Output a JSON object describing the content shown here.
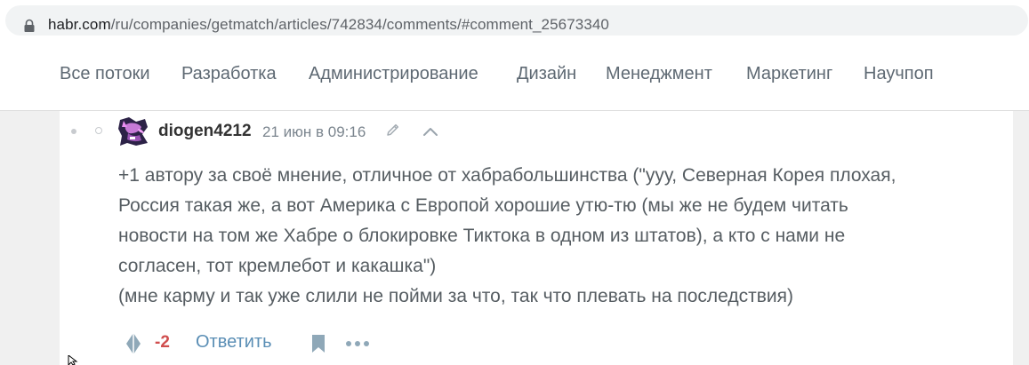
{
  "browser": {
    "url_host": "habr.com",
    "url_path": "/ru/companies/getmatch/articles/742834/comments/#comment_25673340"
  },
  "nav": {
    "items": [
      "Все потоки",
      "Разработка",
      "Администрирование",
      "Дизайн",
      "Менеджмент",
      "Маркетинг",
      "Научпоп"
    ]
  },
  "comment": {
    "username": "diogen4212",
    "timestamp": "21 июн в 09:16",
    "lines": [
      "+1 автору за своё мнение, отличное от хабрабольшинства (\"ууу, Северная Корея плохая,",
      "Россия такая же, а вот Америка с Европой хорошие утю-тю (мы же не будем читать",
      "новости на том же Хабре о блокировке Тиктока в одном из штатов), а кто с нами не",
      "согласен, тот кремлебот и какашка\")",
      "(мне карму и так уже слили не пойми за что, так что плевать на последствия)"
    ],
    "score": "-2",
    "reply_label": "Ответить"
  },
  "colors": {
    "score_negative": "#d04e4e",
    "link": "#5a8eb5",
    "text": "#565d62"
  },
  "icons": [
    "lock-icon",
    "avatar",
    "pencil-icon",
    "chevron-up-icon",
    "vote-icon",
    "bookmark-icon",
    "more-icon"
  ]
}
